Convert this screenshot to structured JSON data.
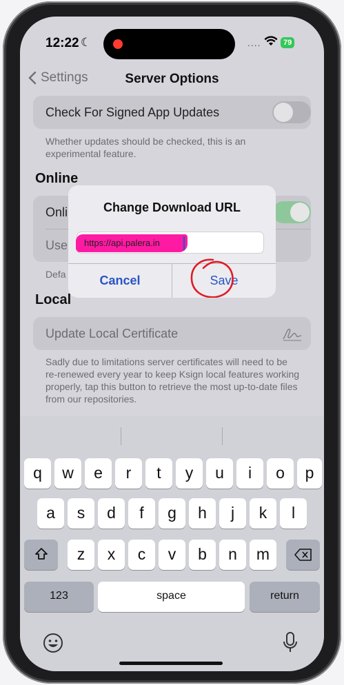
{
  "status": {
    "time": "12:22",
    "signal": "....",
    "battery": "79"
  },
  "nav": {
    "back_label": "Settings",
    "title": "Server Options"
  },
  "settings": {
    "check_updates_label": "Check For Signed App Updates",
    "check_updates_footer": "Whether updates should be checked, this is an experimental feature.",
    "online_header": "Online",
    "online_row1_label": "Onli",
    "online_row2_label": "Use",
    "online_footer": "Defa",
    "local_header": "Local",
    "update_cert_label": "Update Local Certificate",
    "local_footer": "Sadly due to limitations server certificates will need to be re-renewed every year to keep Ksign local features working properly, tap this button to retrieve the most up-to-date files from our repositories."
  },
  "alert": {
    "title": "Change Download URL",
    "input_value": "https://api.palera.in",
    "cancel_label": "Cancel",
    "save_label": "Save"
  },
  "keyboard": {
    "row1": [
      "q",
      "w",
      "e",
      "r",
      "t",
      "y",
      "u",
      "i",
      "o",
      "p"
    ],
    "row2": [
      "a",
      "s",
      "d",
      "f",
      "g",
      "h",
      "j",
      "k",
      "l"
    ],
    "row3": [
      "z",
      "x",
      "c",
      "v",
      "b",
      "n",
      "m"
    ],
    "numbers_label": "123",
    "space_label": "space",
    "return_label": "return"
  },
  "colors": {
    "accent": "#2a54c4",
    "highlight": "#ff1aa3",
    "annotation": "#e01b24",
    "toggle_on": "#34c759"
  },
  "icons": [
    "moon-icon",
    "wifi-icon",
    "chevron-left-icon",
    "signature-icon",
    "shift-icon",
    "delete-icon",
    "emoji-icon",
    "microphone-icon"
  ]
}
